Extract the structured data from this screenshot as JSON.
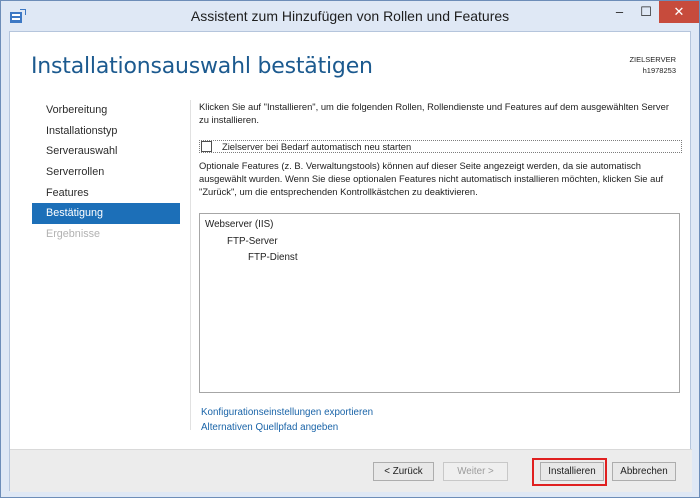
{
  "window": {
    "title": "Assistent zum Hinzufügen von Rollen und Features",
    "controls": {
      "minimize": "–",
      "maximize": "☐",
      "close": "✕"
    }
  },
  "header": {
    "title": "Installationsauswahl bestätigen",
    "target_server_label": "ZIELSERVER",
    "target_server_name": "h1978253"
  },
  "sidebar": {
    "items": [
      {
        "label": "Vorbereitung",
        "state": "normal"
      },
      {
        "label": "Installationstyp",
        "state": "normal"
      },
      {
        "label": "Serverauswahl",
        "state": "normal"
      },
      {
        "label": "Serverrollen",
        "state": "normal"
      },
      {
        "label": "Features",
        "state": "normal"
      },
      {
        "label": "Bestätigung",
        "state": "active"
      },
      {
        "label": "Ergebnisse",
        "state": "disabled"
      }
    ]
  },
  "main": {
    "intro": "Klicken Sie auf \"Installieren\", um die folgenden Rollen, Rollendienste und Features auf dem ausgewählten Server zu installieren.",
    "restart_checkbox_label": "Zielserver bei Bedarf automatisch neu starten",
    "restart_checked": false,
    "optional_note": "Optionale Features (z. B. Verwaltungstools) können auf dieser Seite angezeigt werden, da sie automatisch ausgewählt wurden. Wenn Sie diese optionalen Features nicht automatisch installieren möchten, klicken Sie auf \"Zurück\", um die entsprechenden Kontrollkästchen zu deaktivieren.",
    "features": [
      {
        "label": "Webserver (IIS)",
        "level": 0
      },
      {
        "label": "FTP-Server",
        "level": 1
      },
      {
        "label": "FTP-Dienst",
        "level": 2
      }
    ],
    "links": {
      "export": "Konfigurationseinstellungen exportieren",
      "alt_source": "Alternativen Quellpfad angeben"
    }
  },
  "footer": {
    "back": "< Zurück",
    "next": "Weiter >",
    "install": "Installieren",
    "cancel": "Abbrechen"
  },
  "colors": {
    "heading": "#1c5a8f",
    "nav_active": "#1c6fb8",
    "link": "#1a64a8",
    "close_button": "#c74b3c",
    "highlight": "#e02020"
  }
}
